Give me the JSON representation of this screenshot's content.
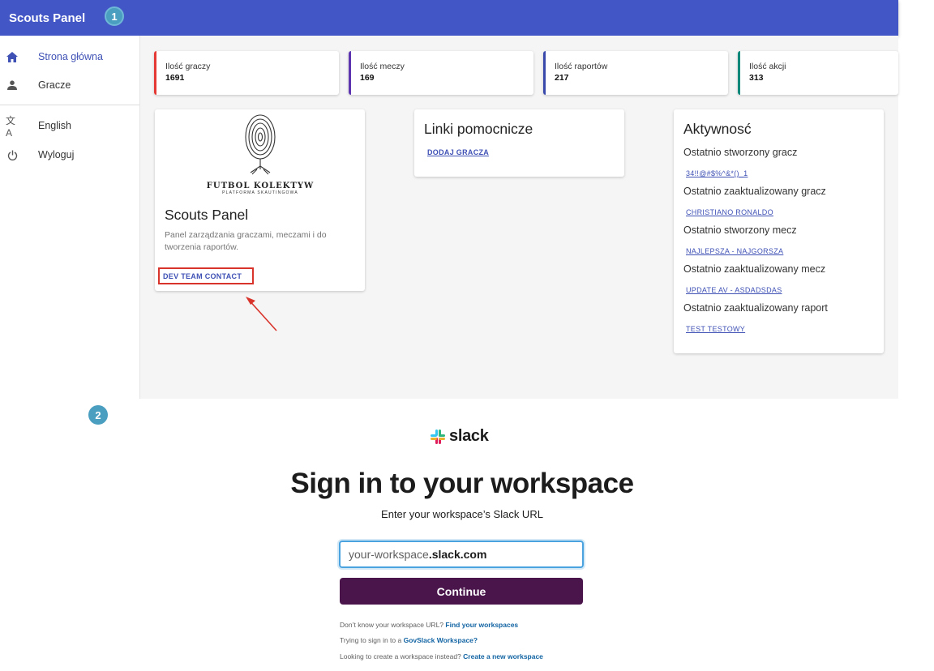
{
  "app": {
    "title": "Scouts Panel"
  },
  "steps": {
    "one": "1",
    "two": "2"
  },
  "sidebar": {
    "items": [
      {
        "label": "Strona główna",
        "icon": "home-icon"
      },
      {
        "label": "Gracze",
        "icon": "person-icon"
      },
      {
        "label": "English",
        "icon": "translate-icon"
      },
      {
        "label": "Wyloguj",
        "icon": "power-icon"
      }
    ]
  },
  "stats": [
    {
      "label": "Ilość graczy",
      "value": "1691",
      "accent": "#e53935"
    },
    {
      "label": "Ilość meczy",
      "value": "169",
      "accent": "#5e35b1"
    },
    {
      "label": "Ilość raportów",
      "value": "217",
      "accent": "#3949ab"
    },
    {
      "label": "Ilość akcji",
      "value": "313",
      "accent": "#00897b"
    }
  ],
  "about_card": {
    "logo_line1": "FUTBOL KOLEKTYW",
    "logo_line2": "PLATFORMA SKAUTINGOWA",
    "title": "Scouts Panel",
    "description": "Panel zarządzania graczami, meczami i do tworzenia raportów.",
    "contact_button": "DEV TEAM CONTACT"
  },
  "links_card": {
    "title": "Linki pomocnicze",
    "add_player": "DODAJ GRACZA"
  },
  "activity_card": {
    "title": "Aktywnosć",
    "entries": [
      {
        "label": "Ostatnio stworzony gracz",
        "link": "34!!@#$%^&*()_1"
      },
      {
        "label": "Ostatnio zaaktualizowany gracz",
        "link": "CHRISTIANO RONALDO"
      },
      {
        "label": "Ostatnio stworzony mecz",
        "link": "NAJLEPSZA - NAJGORSZA"
      },
      {
        "label": "Ostatnio zaaktualizowany mecz",
        "link": "UPDATE AV - ASDADSDAS"
      },
      {
        "label": "Ostatnio zaaktualizowany raport",
        "link": "TEST TESTOWY"
      }
    ]
  },
  "annotation": {
    "highlight_color": "#d9342b"
  },
  "slack": {
    "brand": "slack",
    "heading": "Sign in to your workspace",
    "subheading": "Enter your workspace’s Slack URL",
    "input_prefix": "your-workspace",
    "input_domain": ".slack.com",
    "continue_label": "Continue",
    "button_color": "#4a154b",
    "help": [
      {
        "text": "Don’t know your workspace URL?",
        "link": "Find your workspaces"
      },
      {
        "text": "Trying to sign in to a",
        "link": "GovSlack Workspace?"
      },
      {
        "text": "Looking to create a workspace instead?",
        "link": "Create a new workspace"
      }
    ]
  }
}
